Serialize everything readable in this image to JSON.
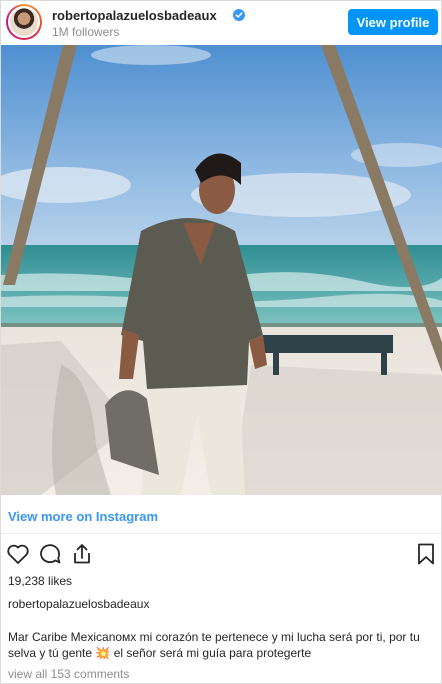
{
  "header": {
    "username": "robertopalazuelosbadeaux",
    "followers": "1M followers",
    "view_profile_label": "View profile"
  },
  "post": {
    "view_more_label": "View more on Instagram",
    "likes": "19,238 likes",
    "caption_username": "robertopalazuelosbadeaux",
    "caption_line1": "Mar Caribe Mexicanoмх mi corazón te pertenece y mi lucha será por ti, por tu",
    "caption_line2_part1": "selva y tú gente",
    "caption_emoji": "💥",
    "caption_line2_part2": "el señor será mi guía para protegerte",
    "view_comments": "view all 153 comments"
  },
  "icons": {
    "verified": "verified-badge-icon",
    "like": "heart-icon",
    "comment": "comment-icon",
    "share": "share-icon",
    "save": "bookmark-icon"
  },
  "colors": {
    "accent": "#0095f6",
    "link": "#3897f0",
    "text": "#262626",
    "muted": "#8e8e8e"
  }
}
